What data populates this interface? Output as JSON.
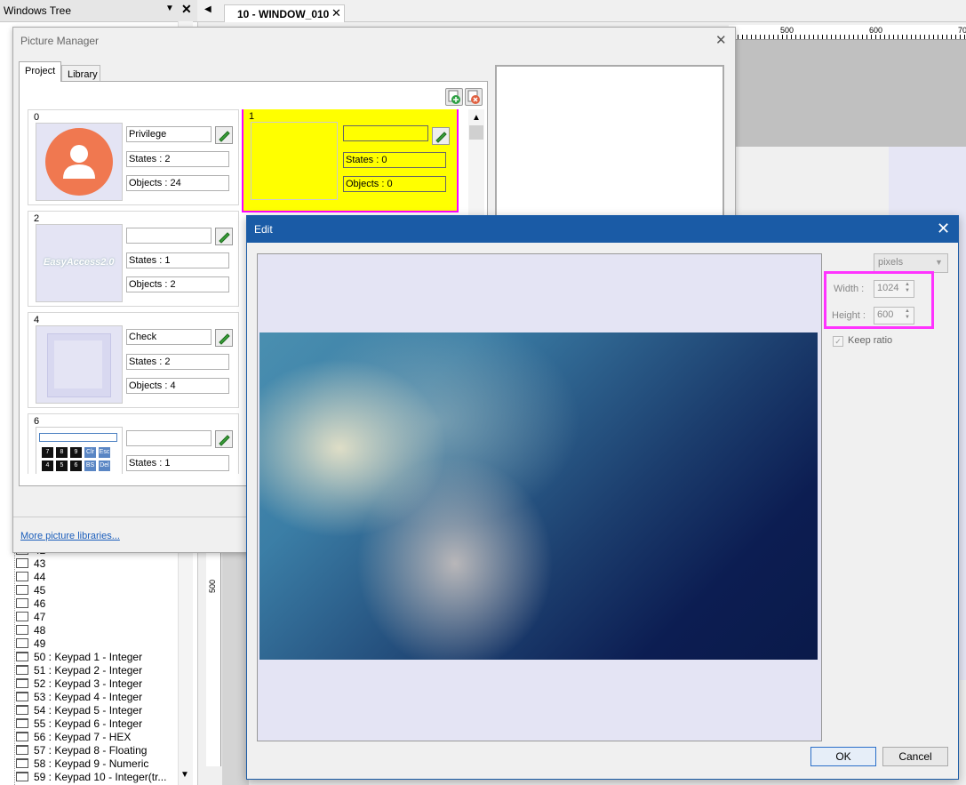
{
  "windows_tree": {
    "title": "Windows Tree",
    "items": [
      {
        "label": "42"
      },
      {
        "label": "43"
      },
      {
        "label": "44"
      },
      {
        "label": "45"
      },
      {
        "label": "46"
      },
      {
        "label": "47"
      },
      {
        "label": "48"
      },
      {
        "label": "49"
      },
      {
        "label": "50 : Keypad 1 - Integer"
      },
      {
        "label": "51 : Keypad 2 - Integer"
      },
      {
        "label": "52 : Keypad 3 - Integer"
      },
      {
        "label": "53 : Keypad 4 - Integer"
      },
      {
        "label": "54 : Keypad 5 - Integer"
      },
      {
        "label": "55 : Keypad 6 - Integer"
      },
      {
        "label": "56 : Keypad 7 - HEX"
      },
      {
        "label": "57 : Keypad 8 - Floating"
      },
      {
        "label": "58 : Keypad 9 - Numeric"
      },
      {
        "label": "59 : Keypad 10 - Integer(tr..."
      }
    ]
  },
  "editor": {
    "tab_label": "10 - WINDOW_010",
    "ruler_top": [
      "500",
      "600",
      "70"
    ],
    "ruler_left": "500"
  },
  "picture_manager": {
    "title": "Picture Manager",
    "tabs": [
      "Project",
      "Library"
    ],
    "cards": [
      {
        "id": "0",
        "name": "Privilege",
        "states": "States : 2",
        "objects": "Objects : 24"
      },
      {
        "id": "1",
        "name": "",
        "states": "States : 0",
        "objects": "Objects : 0"
      },
      {
        "id": "2",
        "name": "",
        "states": "States : 1",
        "objects": "Objects : 2",
        "thumb_text": "EasyAccess2.0"
      },
      {
        "id": "4",
        "name": "Check",
        "states": "States : 2",
        "objects": "Objects : 4"
      },
      {
        "id": "6",
        "name": "",
        "states": "States : 1"
      }
    ],
    "keypad_keys": [
      "7",
      "8",
      "9",
      "Clr",
      "Esc",
      "4",
      "5",
      "6",
      "BS",
      "Del"
    ],
    "more_link": "More picture libraries..."
  },
  "edit_dialog": {
    "title": "Edit",
    "unit": "pixels",
    "width_label": "Width :",
    "width_value": "1024",
    "height_label": "Height :",
    "height_value": "600",
    "keep_ratio_label": "Keep ratio",
    "ok_label": "OK",
    "cancel_label": "Cancel"
  },
  "colors": {
    "selection_yellow": "#ffff00",
    "highlight_magenta": "#ff00ff",
    "dialog_blue": "#1a5ba6",
    "avatar_orange": "#f07850"
  }
}
